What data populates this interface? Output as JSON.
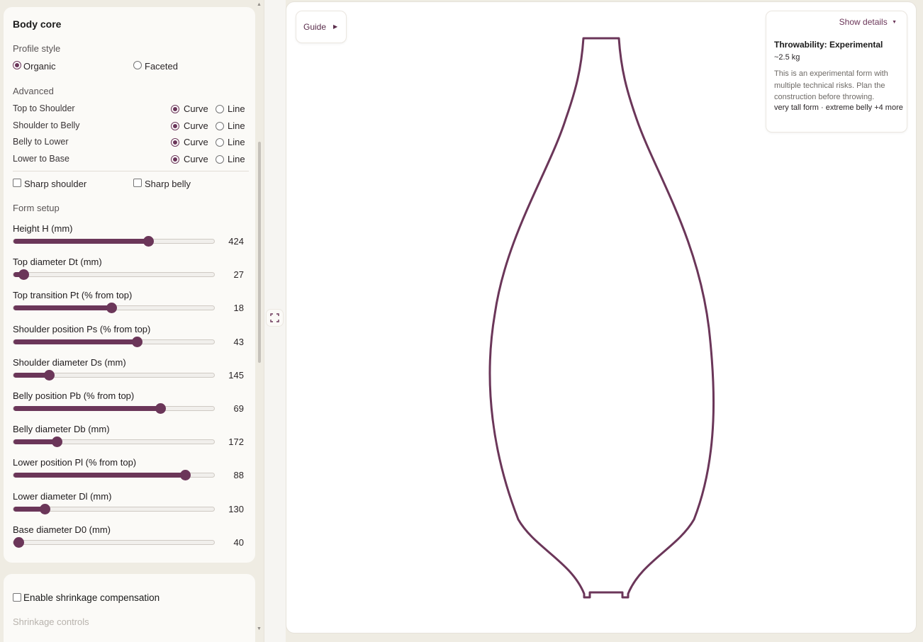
{
  "sidebar": {
    "section_title": "Body core",
    "profile_style": {
      "label": "Profile style",
      "options": [
        {
          "label": "Organic",
          "selected": true
        },
        {
          "label": "Faceted",
          "selected": false
        }
      ]
    },
    "advanced": {
      "label": "Advanced",
      "rows": [
        {
          "label": "Top to Shoulder",
          "curve": "Curve",
          "line": "Line",
          "selected": "curve"
        },
        {
          "label": "Shoulder to Belly",
          "curve": "Curve",
          "line": "Line",
          "selected": "curve"
        },
        {
          "label": "Belly to Lower",
          "curve": "Curve",
          "line": "Line",
          "selected": "curve"
        },
        {
          "label": "Lower to Base",
          "curve": "Curve",
          "line": "Line",
          "selected": "curve"
        }
      ]
    },
    "checks": {
      "sharp_shoulder": {
        "label": "Sharp shoulder",
        "checked": false
      },
      "sharp_belly": {
        "label": "Sharp belly",
        "checked": false
      }
    },
    "form_setup": {
      "label": "Form setup",
      "sliders": [
        {
          "label": "Height H (mm)",
          "value": "424",
          "fraction": 0.665
        },
        {
          "label": "Top diameter Dt (mm)",
          "value": "27",
          "fraction": 0.05
        },
        {
          "label": "Top transition Pt (% from top)",
          "value": "18",
          "fraction": 0.485
        },
        {
          "label": "Shoulder position Ps (% from top)",
          "value": "43",
          "fraction": 0.61
        },
        {
          "label": "Shoulder diameter Ds (mm)",
          "value": "145",
          "fraction": 0.175
        },
        {
          "label": "Belly position Pb (% from top)",
          "value": "69",
          "fraction": 0.725
        },
        {
          "label": "Belly diameter Db (mm)",
          "value": "172",
          "fraction": 0.215
        },
        {
          "label": "Lower position Pl (% from top)",
          "value": "88",
          "fraction": 0.85
        },
        {
          "label": "Lower diameter Dl (mm)",
          "value": "130",
          "fraction": 0.155
        },
        {
          "label": "Base diameter D0 (mm)",
          "value": "40",
          "fraction": 0.025
        }
      ]
    },
    "shrinkage": {
      "enable_label": "Enable shrinkage compensation",
      "checked": false,
      "controls_label": "Shrinkage controls"
    }
  },
  "canvas": {
    "guide_label": "Guide",
    "details": {
      "toggle_label": "Show details",
      "throwability": "Throwability: Experimental",
      "weight": "~2.5 kg",
      "description": "This is an experimental form with multiple technical risks. Plan the construction before throwing.",
      "tags": "very tall form · extreme belly +4 more"
    },
    "outline_color": "#6b3659"
  },
  "colors": {
    "accent": "#6b3659",
    "background": "#efece3",
    "panel": "#fbfaf7"
  }
}
